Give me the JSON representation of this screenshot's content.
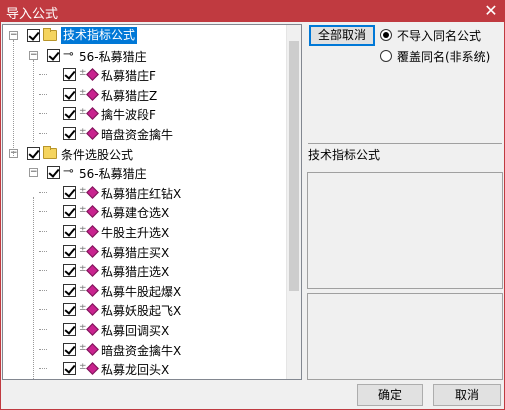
{
  "window": {
    "title": "导入公式",
    "close_symbol": "✕"
  },
  "tree": {
    "nodes": [
      {
        "level": 0,
        "type": "folder",
        "label": "技术指标公式",
        "selected": true,
        "expander": "−"
      },
      {
        "level": 1,
        "type": "key",
        "label": "56-私募猎庄",
        "expander": "−"
      },
      {
        "level": 2,
        "type": "formula",
        "label": "私募猎庄F"
      },
      {
        "level": 2,
        "type": "formula",
        "label": "私募猎庄Z"
      },
      {
        "level": 2,
        "type": "formula",
        "label": "擒牛波段F"
      },
      {
        "level": 2,
        "type": "formula",
        "label": "暗盘资金擒牛"
      },
      {
        "level": 0,
        "type": "folder",
        "label": "条件选股公式",
        "expander": "−"
      },
      {
        "level": 1,
        "type": "key",
        "label": "56-私募猎庄",
        "expander": "−"
      },
      {
        "level": 2,
        "type": "formula",
        "label": "私募猎庄红钻X"
      },
      {
        "level": 2,
        "type": "formula",
        "label": "私募建仓选X"
      },
      {
        "level": 2,
        "type": "formula",
        "label": "牛股主升选X"
      },
      {
        "level": 2,
        "type": "formula",
        "label": "私募猎庄买X"
      },
      {
        "level": 2,
        "type": "formula",
        "label": "私募猎庄选X"
      },
      {
        "level": 2,
        "type": "formula",
        "label": "私募牛股起爆X"
      },
      {
        "level": 2,
        "type": "formula",
        "label": "私募妖股起飞X"
      },
      {
        "level": 2,
        "type": "formula",
        "label": "私募回调买X"
      },
      {
        "level": 2,
        "type": "formula",
        "label": "暗盘资金擒牛X"
      },
      {
        "level": 2,
        "type": "formula",
        "label": "私募龙回头X"
      }
    ]
  },
  "options": {
    "deselect_all_label": "全部取消",
    "radio_no_import_same": "不导入同名公式",
    "radio_overwrite_same": "覆盖同名(非系统)"
  },
  "info": {
    "category_label": "技术指标公式"
  },
  "buttons": {
    "ok": "确定",
    "cancel": "取消"
  }
}
